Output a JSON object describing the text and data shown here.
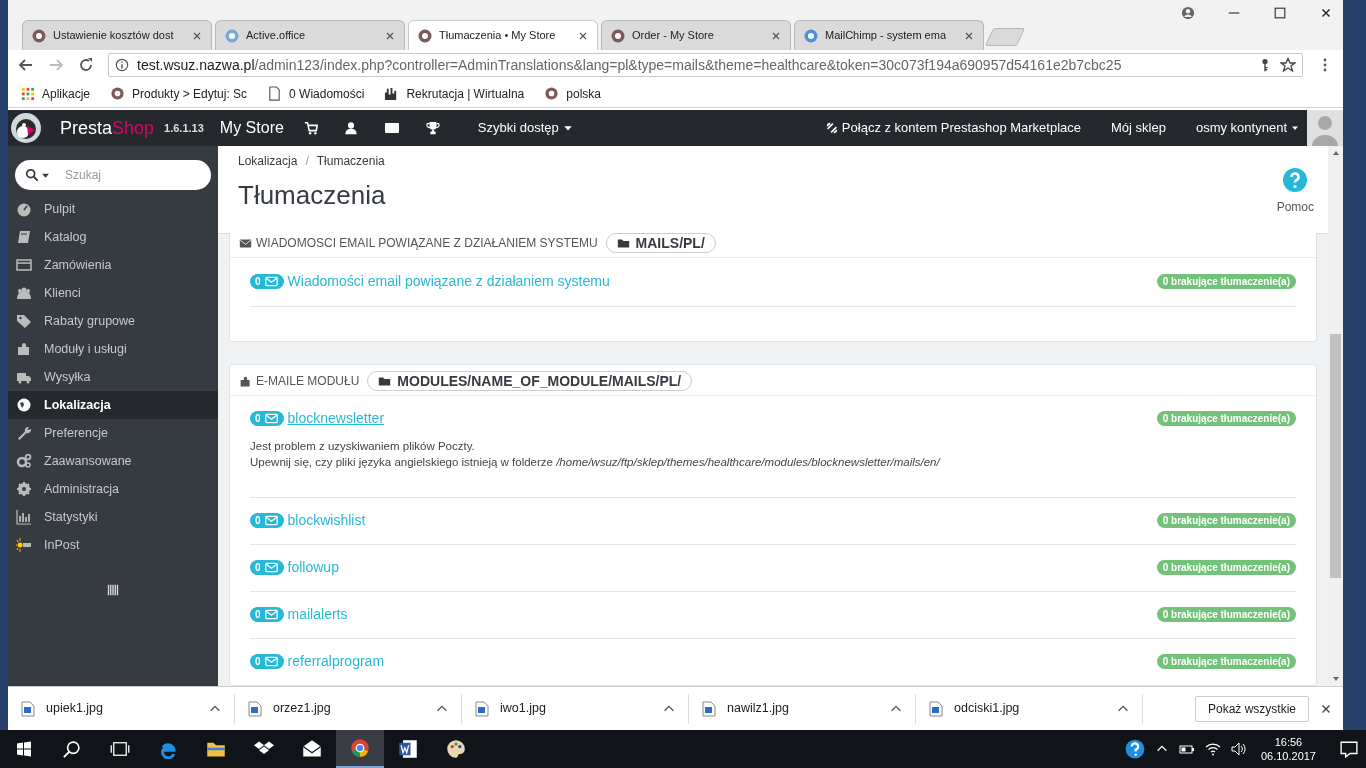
{
  "browser": {
    "tabs": [
      {
        "title": "Ustawienie kosztów dost",
        "selected": false
      },
      {
        "title": "Active.office",
        "selected": false
      },
      {
        "title": "Tłumaczenia • My Store",
        "selected": true
      },
      {
        "title": "Order - My Store",
        "selected": false
      },
      {
        "title": "MailChimp - system ema",
        "selected": false
      }
    ],
    "url_host": "test.wsuz.nazwa.pl",
    "url_path": "/admin123/index.php?controller=AdminTranslations&lang=pl&type=mails&theme=healthcare&token=30c073f194a690957d54161e2b7cbc25",
    "bookmarks": [
      "Aplikacje",
      "Produkty > Edytuj: Sc",
      "0 Wiadomości",
      "Rekrutacja | Wirtualna",
      "polska"
    ]
  },
  "header": {
    "brand": "Presta",
    "brand_accent": "Shop",
    "version": "1.6.1.13",
    "store": "My Store",
    "quick_access": "Szybki dostęp",
    "marketplace": "Połącz z kontem Prestashop Marketplace",
    "my_shop": "Mój sklep",
    "user": "osmy kontynent"
  },
  "sidebar": {
    "search_placeholder": "Szukaj",
    "items": [
      {
        "label": "Pulpit",
        "selected": false
      },
      {
        "label": "Katalog",
        "selected": false
      },
      {
        "label": "Zamówienia",
        "selected": false
      },
      {
        "label": "Klienci",
        "selected": false
      },
      {
        "label": "Rabaty grupowe",
        "selected": false
      },
      {
        "label": "Moduły i usługi",
        "selected": false
      },
      {
        "label": "Wysyłka",
        "selected": false
      },
      {
        "label": "Lokalizacja",
        "selected": true
      },
      {
        "label": "Preferencje",
        "selected": false
      },
      {
        "label": "Zaawansowane",
        "selected": false
      },
      {
        "label": "Administracja",
        "selected": false
      },
      {
        "label": "Statystyki",
        "selected": false
      },
      {
        "label": "InPost",
        "selected": false
      }
    ]
  },
  "page": {
    "breadcrumb": [
      "Lokalizacja",
      "Tłumaczenia"
    ],
    "breadcrumb_separator": "/",
    "title": "Tłumaczenia",
    "help": "Pomoc"
  },
  "panels": [
    {
      "heading": "WIADOMOSCI EMAIL POWIĄZANE Z DZIAŁANIEM SYSTEMU",
      "path": "MAILS/PL/",
      "rows": [
        {
          "count": "0",
          "name": "Wiadomości email powiązane z działaniem systemu",
          "missing": "0 brakujące tłumaczenie(a)",
          "hovered": false
        }
      ]
    },
    {
      "heading": "E-MAILE MODUŁU",
      "path": "MODULES/NAME_OF_MODULE/MAILS/PL/",
      "rows": [
        {
          "count": "0",
          "name": "blocknewsletter",
          "missing": "0 brakujące tłumaczenie(a)",
          "hovered": true,
          "messages": [
            "Jest problem z uzyskiwaniem plików Poczty.",
            "Upewnij się, czy pliki języka angielskiego istnieją w folderze */home/wsuz/ftp/sklep/themes/healthcare/modules/blocknewsletter/mails/en/*"
          ]
        },
        {
          "count": "0",
          "name": "blockwishlist",
          "missing": "0 brakujące tłumaczenie(a)",
          "hovered": false
        },
        {
          "count": "0",
          "name": "followup",
          "missing": "0 brakujące tłumaczenie(a)",
          "hovered": false
        },
        {
          "count": "0",
          "name": "mailalerts",
          "missing": "0 brakujące tłumaczenie(a)",
          "hovered": false
        },
        {
          "count": "0",
          "name": "referralprogram",
          "missing": "0 brakujące tłumaczenie(a)",
          "hovered": false
        }
      ]
    }
  ],
  "downloads": {
    "files": [
      "upiek1.jpg",
      "orzez1.jpg",
      "iwo1.jpg",
      "nawilz1.jpg",
      "odciski1.jpg"
    ],
    "show_all": "Pokaż wszystkie"
  },
  "taskbar": {
    "time": "16:56",
    "date": "06.10.2017"
  }
}
